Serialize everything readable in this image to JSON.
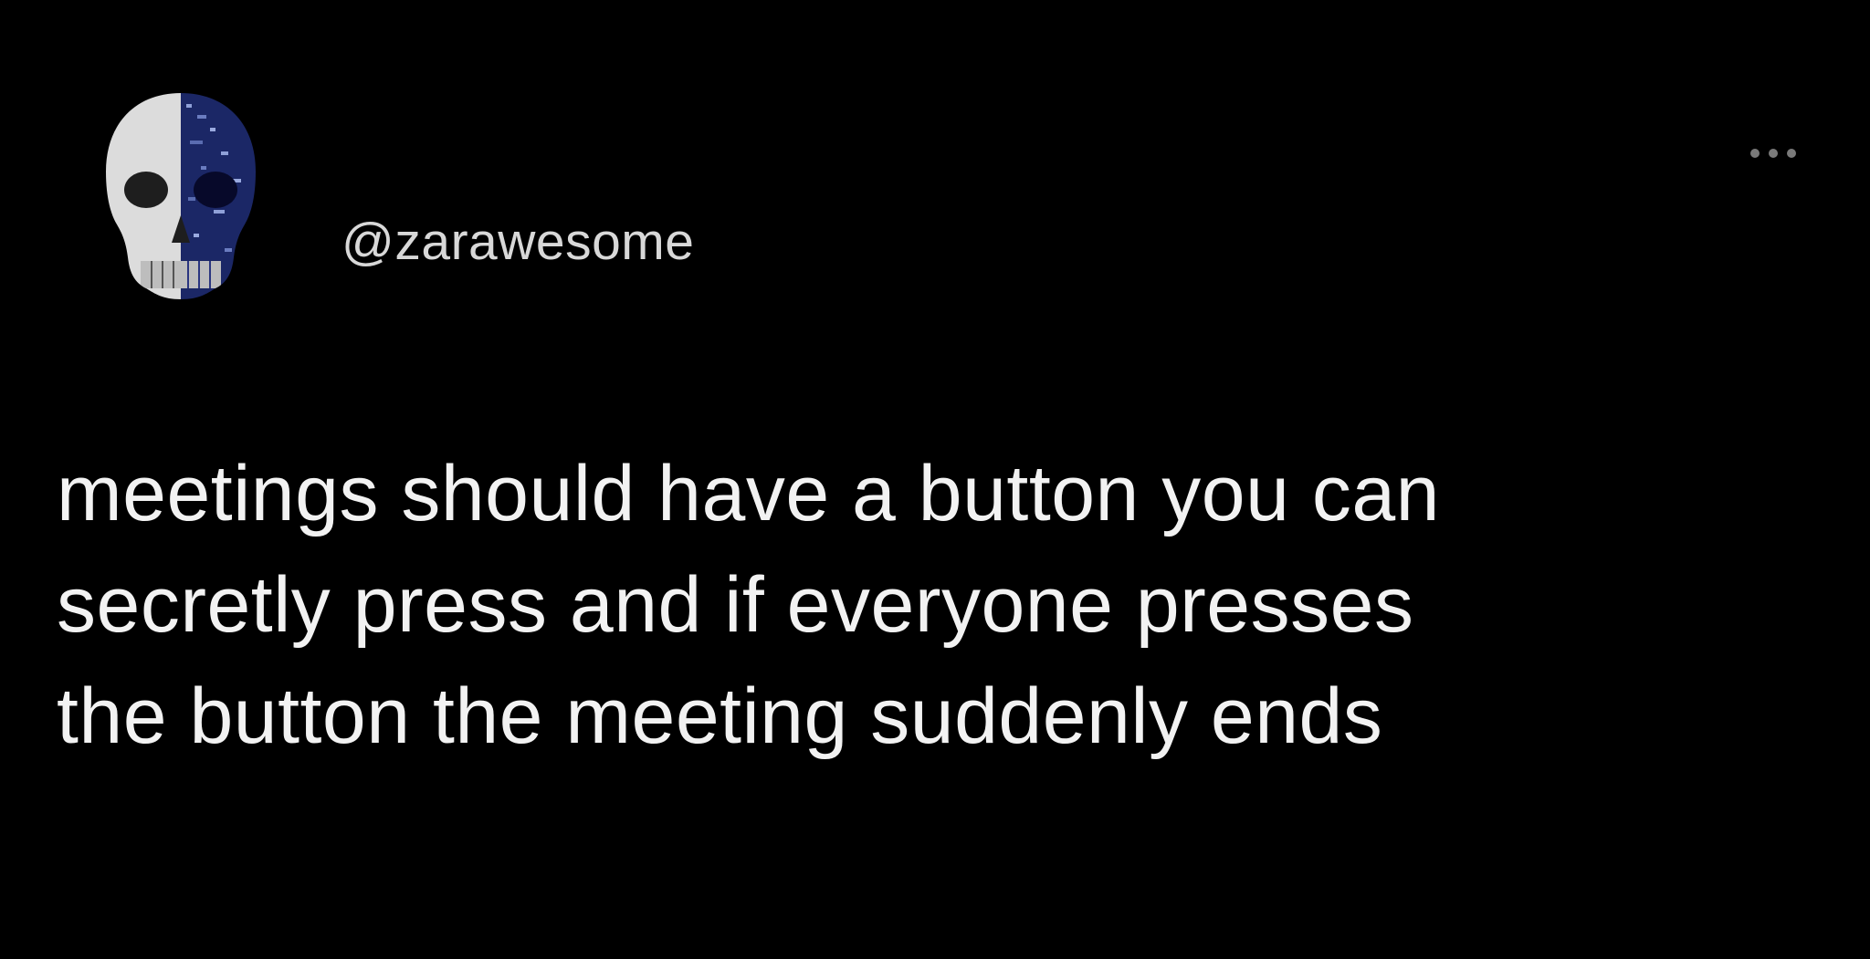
{
  "tweet": {
    "handle": "@zarawesome",
    "more_icon": "more-horizontal-icon",
    "avatar_icon": "skull-icon",
    "text_lines": [
      "meetings should have a button you can",
      "secretly press and if everyone presses",
      "the button the meeting suddenly ends"
    ]
  },
  "colors": {
    "background": "#000000",
    "text": "#f2f2f2",
    "handle": "#d8d8d8",
    "dots": "#7a7a7a",
    "avatar_blue": "#1b2766"
  }
}
